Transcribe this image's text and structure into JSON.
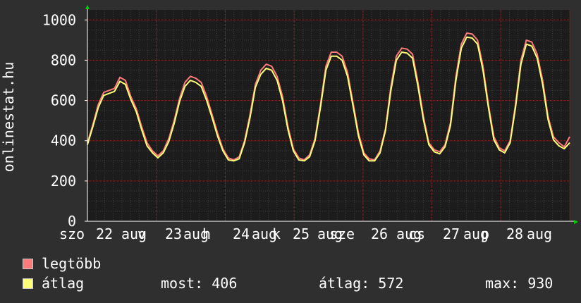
{
  "chart_data": {
    "type": "line",
    "ylabel": "onlinestat.hu",
    "ylim": [
      0,
      1050
    ],
    "yticks": [
      0,
      200,
      400,
      600,
      800,
      1000
    ],
    "grid": true,
    "x_tick_labels": [
      "szo",
      "22",
      "aug",
      "v",
      "23",
      "aug",
      "h",
      "24",
      "aug",
      "k",
      "25",
      "aug",
      "sze",
      "26",
      "aug",
      "cs",
      "27",
      "aug",
      "p",
      "28",
      "aug"
    ],
    "series": [
      {
        "name": "legtöbb",
        "color": "#ff7a7a",
        "values": [
          390,
          480,
          580,
          640,
          650,
          660,
          715,
          700,
          620,
          560,
          470,
          390,
          350,
          325,
          350,
          410,
          500,
          610,
          690,
          720,
          710,
          690,
          620,
          530,
          440,
          360,
          315,
          305,
          320,
          400,
          530,
          680,
          750,
          780,
          770,
          720,
          620,
          470,
          360,
          315,
          305,
          330,
          410,
          580,
          770,
          840,
          840,
          820,
          740,
          590,
          440,
          340,
          310,
          305,
          350,
          460,
          670,
          820,
          860,
          855,
          830,
          690,
          520,
          390,
          355,
          345,
          380,
          490,
          720,
          880,
          935,
          930,
          900,
          770,
          580,
          420,
          365,
          350,
          400,
          580,
          800,
          900,
          890,
          830,
          700,
          520,
          420,
          390,
          370,
          420
        ]
      },
      {
        "name": "átlag",
        "color": "#ffff77",
        "values": [
          380,
          470,
          565,
          625,
          635,
          645,
          695,
          680,
          605,
          545,
          455,
          375,
          340,
          315,
          340,
          395,
          485,
          595,
          670,
          700,
          690,
          670,
          600,
          515,
          425,
          350,
          305,
          300,
          310,
          390,
          515,
          665,
          730,
          760,
          750,
          700,
          600,
          455,
          350,
          305,
          300,
          320,
          400,
          565,
          750,
          820,
          820,
          800,
          720,
          575,
          425,
          330,
          300,
          300,
          340,
          450,
          650,
          800,
          840,
          835,
          810,
          670,
          505,
          380,
          345,
          335,
          370,
          475,
          700,
          860,
          915,
          910,
          880,
          750,
          565,
          405,
          355,
          340,
          390,
          565,
          780,
          880,
          870,
          810,
          680,
          505,
          405,
          375,
          360,
          390
        ]
      }
    ]
  },
  "stats": {
    "current": "most: 406",
    "average": "átlag: 572",
    "max": "max: 930"
  }
}
